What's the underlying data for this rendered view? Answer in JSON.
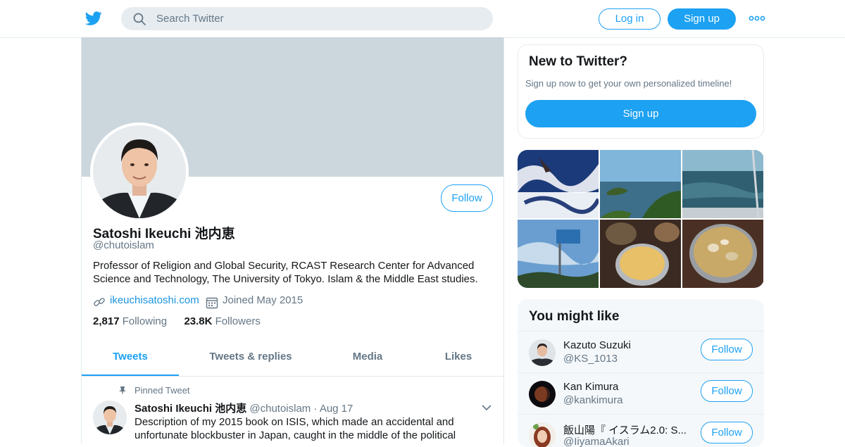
{
  "header": {
    "search_placeholder": "Search Twitter",
    "login_label": "Log in",
    "signup_label": "Sign up",
    "logo_icon": "twitter-bird-icon",
    "more_icon": "more-dots-icon",
    "accent_color": "#1da1f2"
  },
  "profile": {
    "name": "Satoshi Ikeuchi 池内恵",
    "handle": "@chutoislam",
    "follow_label": "Follow",
    "bio": "Professor of Religion and Global Security, RCAST Research Center for Advanced Science and Technology, The University of Tokyo. Islam & the Middle East studies.",
    "website": "ikeuchisatoshi.com",
    "joined": "Joined May 2015",
    "following_count": "2,817",
    "following_label": "Following",
    "followers_count": "23.8K",
    "followers_label": "Followers"
  },
  "tabs": [
    {
      "label": "Tweets",
      "active": true
    },
    {
      "label": "Tweets & replies",
      "active": false
    },
    {
      "label": "Media",
      "active": false
    },
    {
      "label": "Likes",
      "active": false
    }
  ],
  "pinned_tweet": {
    "pinned_label": "Pinned Tweet",
    "author_name": "Satoshi Ikeuchi 池内恵",
    "author_handle": "@chutoislam",
    "separator": "·",
    "date": "Aug 17",
    "text": "Description of my 2015 book on ISIS, which made an accidental and unfortunate blockbuster in Japan, caught in the middle of the political"
  },
  "sidebar": {
    "new_title": "New to Twitter?",
    "new_subtitle": "Sign up now to get your own personalized timeline!",
    "new_signup_label": "Sign up",
    "you_might_like_title": "You might like",
    "suggestions": [
      {
        "name": "Kazuto Suzuki",
        "handle": "@KS_1013",
        "follow_label": "Follow"
      },
      {
        "name": "Kan Kimura",
        "handle": "@kankimura",
        "follow_label": "Follow"
      },
      {
        "name": "飯山陽『 イスラム2.0: S...",
        "handle": "@IiyamaAkari",
        "follow_label": "Follow"
      }
    ]
  }
}
